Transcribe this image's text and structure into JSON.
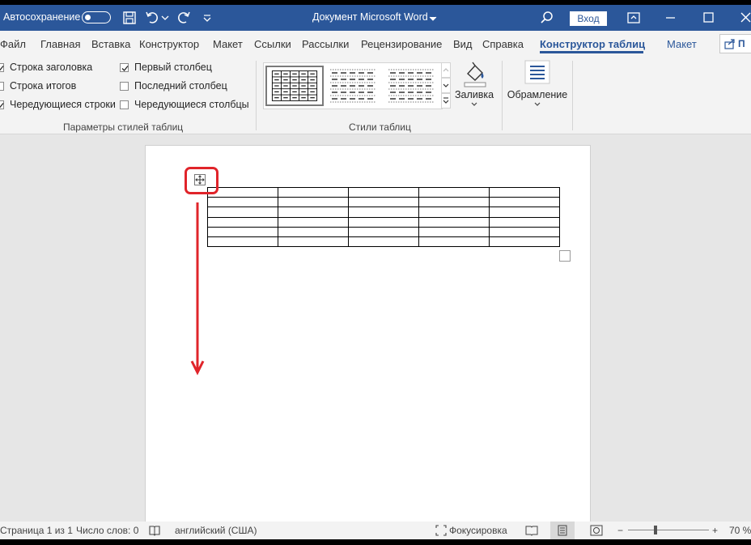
{
  "titlebar": {
    "autosave_label": "Автосохранение",
    "doc_title": "Документ Microsoft Word",
    "login_label": "Вход",
    "bg_color": "#2b579a"
  },
  "tabs": [
    {
      "label": "Файл"
    },
    {
      "label": "Главная"
    },
    {
      "label": "Вставка"
    },
    {
      "label": "Конструктор"
    },
    {
      "label": "Макет"
    },
    {
      "label": "Ссылки"
    },
    {
      "label": "Рассылки"
    },
    {
      "label": "Рецензирование"
    },
    {
      "label": "Вид"
    },
    {
      "label": "Справка"
    },
    {
      "label": "Конструктор таблиц",
      "active": true
    },
    {
      "label": "Макет"
    }
  ],
  "share": {
    "label": "П"
  },
  "ribbon": {
    "style_options": {
      "header_row": {
        "label": "Строка заголовка",
        "checked": true
      },
      "total_row": {
        "label": "Строка итогов",
        "checked": false
      },
      "banded_rows": {
        "label": "Чередующиеся строки",
        "checked": true
      },
      "first_column": {
        "label": "Первый столбец",
        "checked": true
      },
      "last_column": {
        "label": "Последний столбец",
        "checked": false
      },
      "banded_columns": {
        "label": "Чередующиеся столбцы",
        "checked": false
      },
      "group_label": "Параметры стилей таблиц"
    },
    "table_styles": {
      "group_label": "Стили таблиц"
    },
    "shading": {
      "label": "Заливка"
    },
    "borders": {
      "label": "Обрамление"
    }
  },
  "document": {
    "table": {
      "rows": 6,
      "cols": 5
    },
    "annotation_color": "#e0242a"
  },
  "statusbar": {
    "page": "Страница 1 из 1",
    "words": "Число слов: 0",
    "language": "английский (США)",
    "focus": "Фокусировка",
    "zoom_out": "−",
    "zoom_in": "+",
    "zoom": "70 %"
  }
}
